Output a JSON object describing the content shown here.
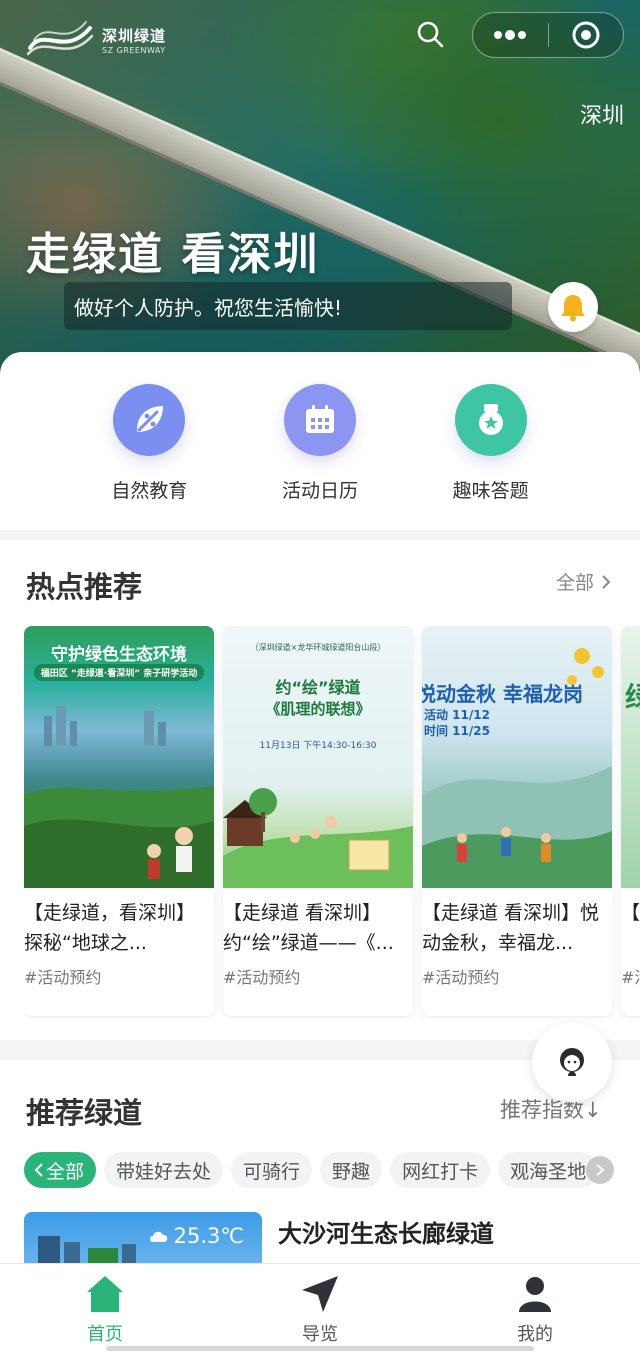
{
  "header": {
    "logo_text": "深圳绿道",
    "logo_sub": "SZ GREENWAY",
    "city": "深圳",
    "title": "走绿道 看深圳",
    "notice": "做好个人防护。祝您生活愉快!"
  },
  "quick_entries": [
    {
      "label": "自然教育",
      "icon": "leaf-icon",
      "color": "#7b8ff0"
    },
    {
      "label": "活动日历",
      "icon": "calendar-icon",
      "color": "#8d95f3"
    },
    {
      "label": "趣味答题",
      "icon": "medal-icon",
      "color": "#3ec6a4"
    }
  ],
  "hot": {
    "title": "热点推荐",
    "see_all": "全部",
    "cards": [
      {
        "title": "【走绿道，看深圳】 探秘“地球之...",
        "tag": "#活动预约",
        "banner_line1": "守护绿色生态环境",
        "banner_line2": "福田区 “走绿道·看深圳” 亲子研学活动"
      },
      {
        "title": "【走绿道 看深圳】约“绘”绿道——《...",
        "tag": "#活动预约",
        "banner_head": "（深圳绿道×龙华环城绿道阳台山段）",
        "banner_line1": "约“绘”绿道",
        "banner_line2": "《肌理的联想》",
        "banner_line3": "11月13日  下午14:30-16:30"
      },
      {
        "title": "【走绿道 看深圳】悦动金秋，幸福龙...",
        "tag": "#活动预约",
        "banner_line1": "悦动金秋  幸福龙岗",
        "banner_line2": "活动 11/12",
        "banner_line3": "时间 11/25"
      },
      {
        "title": "【",
        "tag": "#活",
        "banner_line1": "绿"
      }
    ]
  },
  "recommend": {
    "title": "推荐绿道",
    "index_label": "推荐指数↓",
    "chips": [
      "全部",
      "带娃好去处",
      "可骑行",
      "野趣",
      "网红打卡",
      "观海圣地"
    ],
    "first_item": {
      "name": "大沙河生态长廊绿道",
      "temperature": "25.3℃"
    }
  },
  "tabbar": [
    {
      "label": "首页",
      "icon": "home-icon",
      "active": true
    },
    {
      "label": "导览",
      "icon": "navigation-icon",
      "active": false
    },
    {
      "label": "我的",
      "icon": "user-icon",
      "active": false
    }
  ],
  "colors": {
    "accent": "#2bb47a"
  }
}
